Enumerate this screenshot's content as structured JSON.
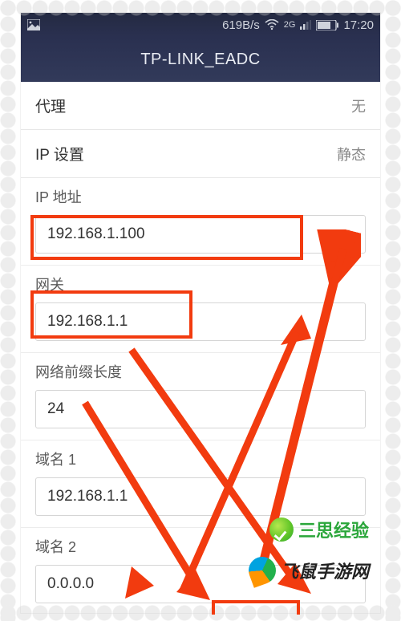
{
  "statusbar": {
    "speed": "619B/s",
    "network_label": "2G",
    "time": "17:20"
  },
  "title": "TP-LINK_EADC",
  "rows": {
    "proxy": {
      "label": "代理",
      "value": "无"
    },
    "ip_settings": {
      "label": "IP 设置",
      "value": "静态"
    }
  },
  "fields": {
    "ip_address": {
      "label": "IP 地址",
      "value": "192.168.1.100"
    },
    "gateway": {
      "label": "网关",
      "value": "192.168.1.1"
    },
    "prefix": {
      "label": "网络前缀长度",
      "value": "24"
    },
    "dns1": {
      "label": "域名 1",
      "value": "192.168.1.1"
    },
    "dns2": {
      "label": "域名 2",
      "value": "0.0.0.0"
    }
  },
  "watermarks": {
    "sansi": "三思经验",
    "feishu": "飞鼠手游网"
  },
  "colors": {
    "annotation_red": "#f23b0f",
    "header_bg": "#2d3556"
  }
}
